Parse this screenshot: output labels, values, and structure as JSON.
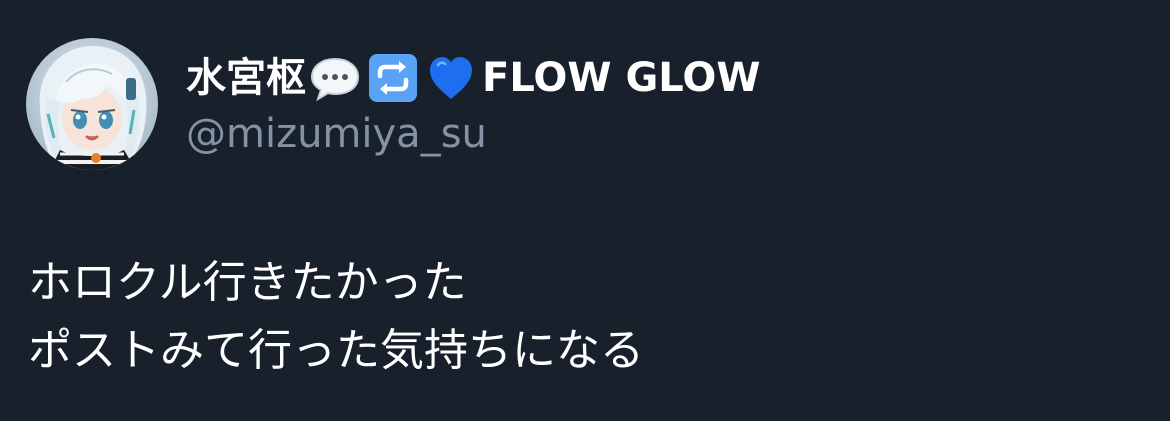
{
  "author": {
    "display_name": "水宮枢",
    "name_suffix": "FLOW GLOW",
    "handle": "@mizumiya_su",
    "emojis": [
      "speech-balloon-icon",
      "repeat-arrows-icon",
      "blue-heart-icon"
    ]
  },
  "post": {
    "lines": [
      "ホロクル行きたかった",
      "ポストみて行った気持ちになる"
    ]
  },
  "colors": {
    "background": "#17202b",
    "text_primary": "#ffffff",
    "text_secondary": "#8393a5",
    "heart_blue": "#1d6ff0",
    "repeat_tile": "#5aa2f5"
  }
}
